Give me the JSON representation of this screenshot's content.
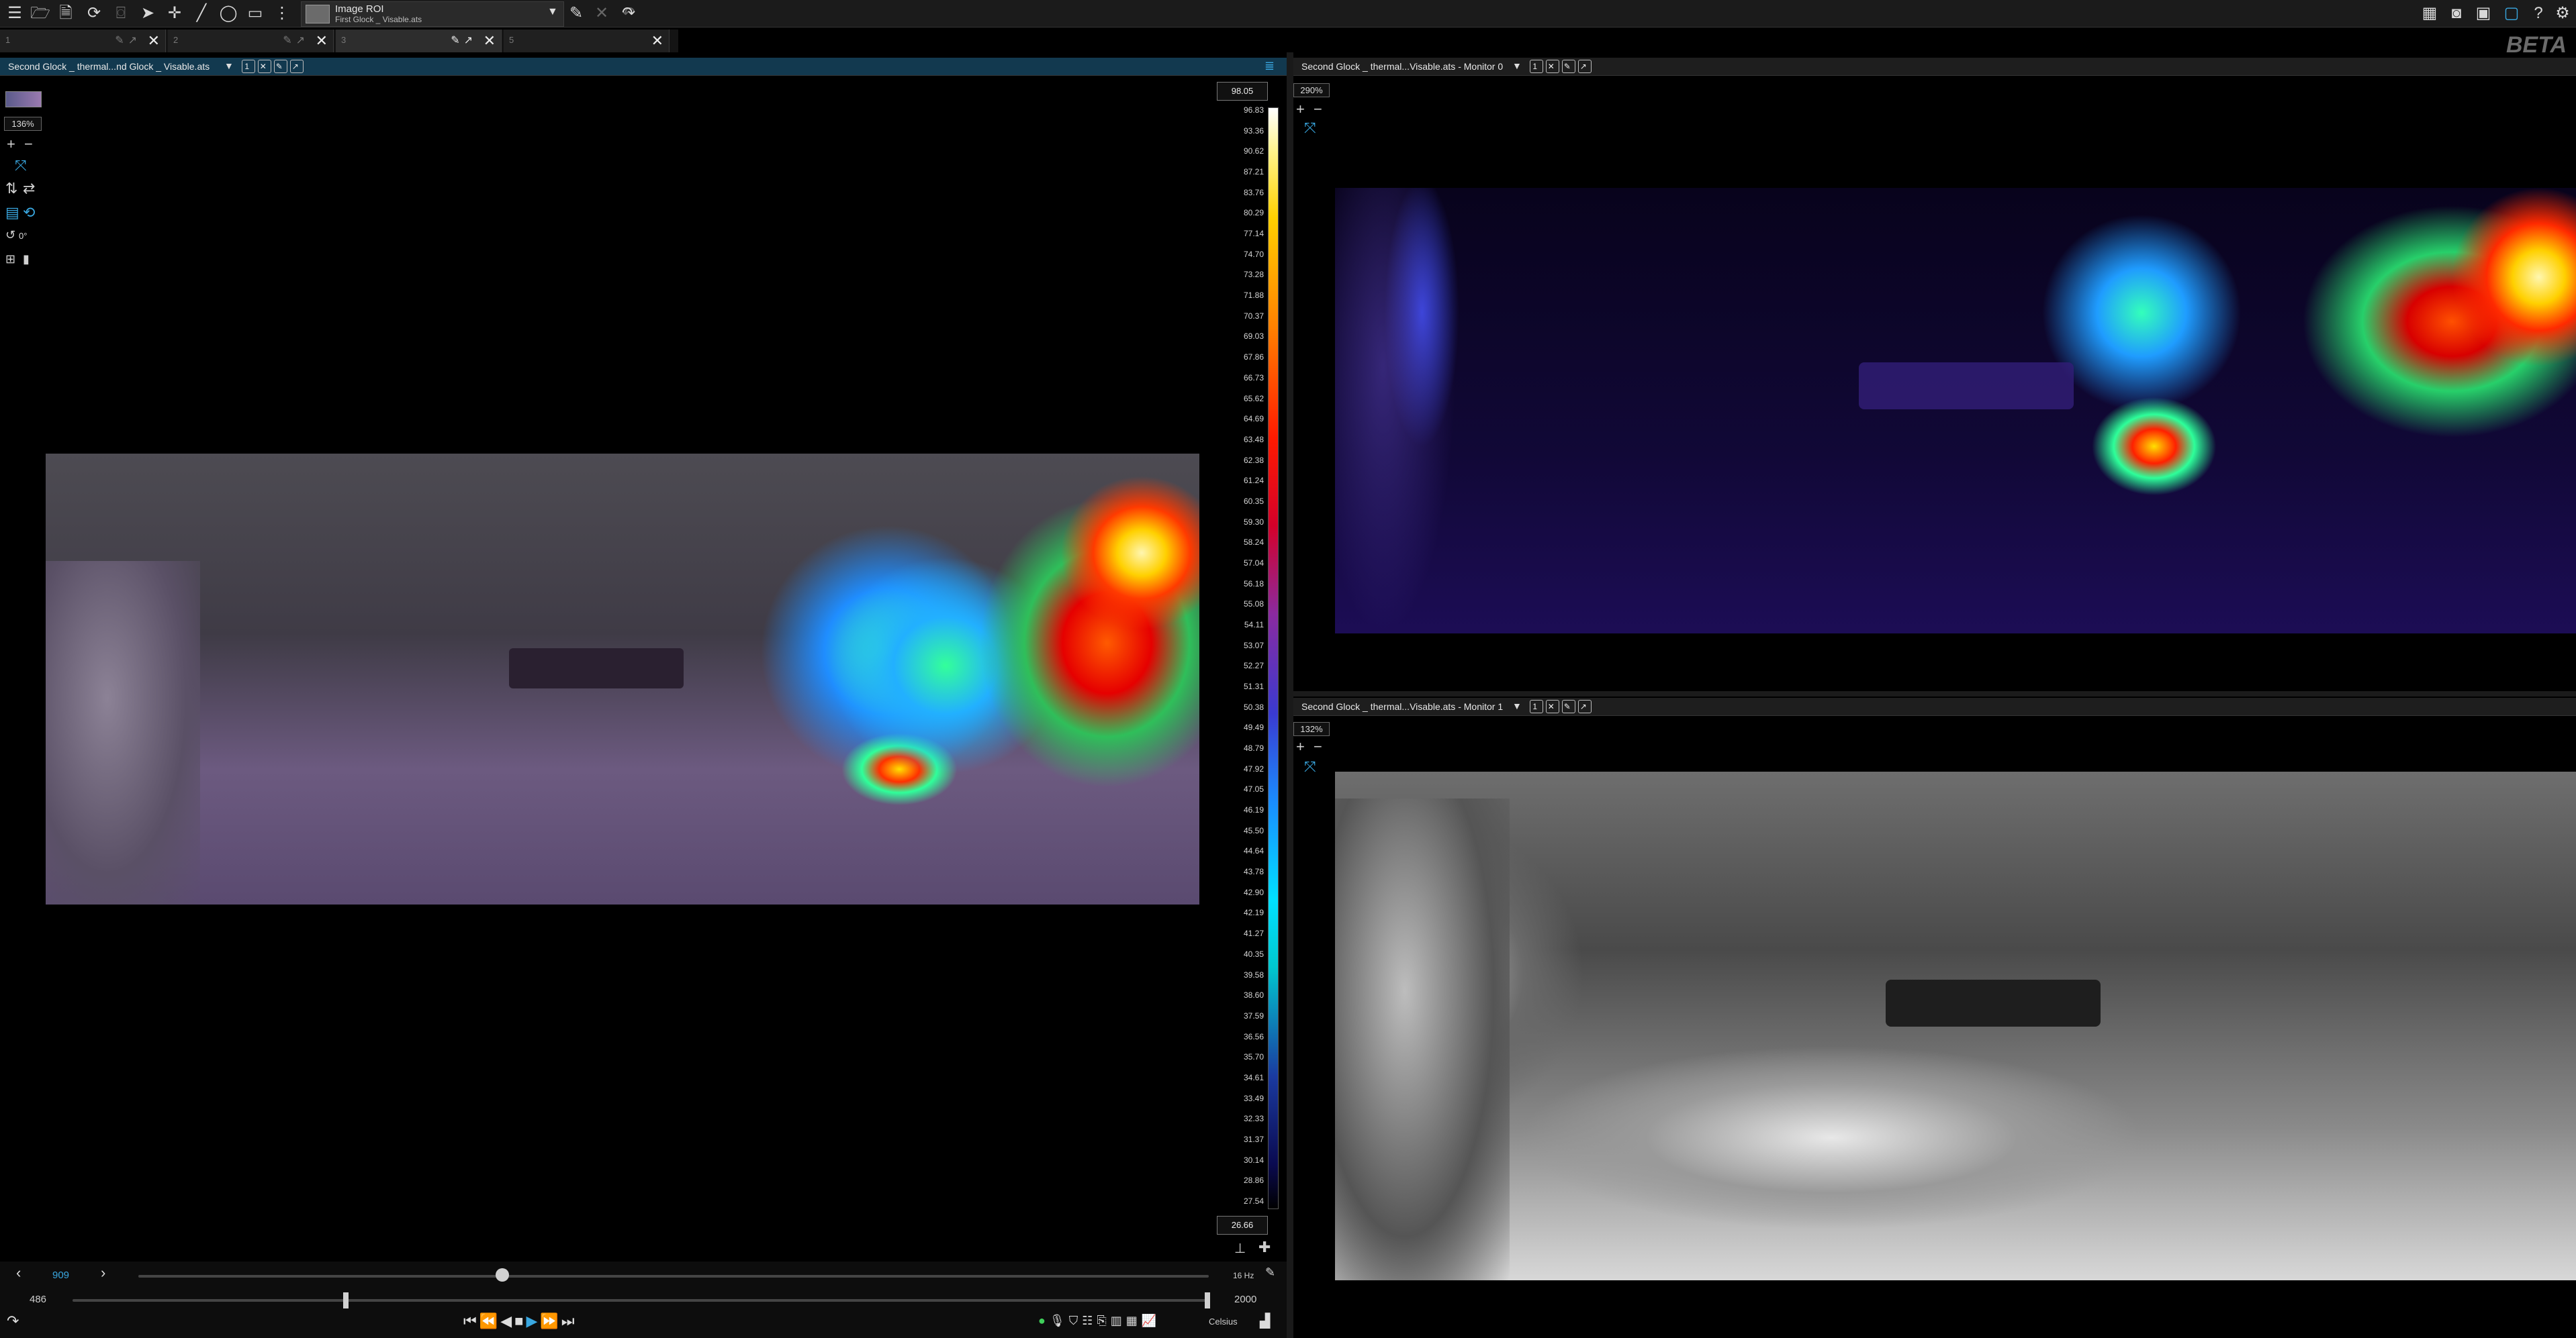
{
  "toolbar": {
    "roi_title": "Image ROI",
    "roi_subtitle": "First Glock _ Visable.ats",
    "beta_label": "BETA"
  },
  "tabs": [
    {
      "label": "1",
      "active": false
    },
    {
      "label": "2",
      "active": false
    },
    {
      "label": "3",
      "active": true
    },
    {
      "label": "5",
      "active": false
    }
  ],
  "main_panel": {
    "title": "Second Glock _ thermal...nd Glock _ Visable.ats",
    "zoom": "136%",
    "rotation": "0°"
  },
  "monitor0": {
    "title": "Second Glock _ thermal...Visable.ats - Monitor 0",
    "zoom": "290%"
  },
  "monitor1": {
    "title": "Second Glock _ thermal...Visable.ats - Monitor 1",
    "zoom": "132%"
  },
  "colorbar": {
    "max": "98.05",
    "min": "26.66",
    "ticks": [
      "96.83",
      "93.36",
      "90.62",
      "87.21",
      "83.76",
      "80.29",
      "77.14",
      "74.70",
      "73.28",
      "71.88",
      "70.37",
      "69.03",
      "67.86",
      "66.73",
      "65.62",
      "64.69",
      "63.48",
      "62.38",
      "61.24",
      "60.35",
      "59.30",
      "58.24",
      "57.04",
      "56.18",
      "55.08",
      "54.11",
      "53.07",
      "52.27",
      "51.31",
      "50.38",
      "49.49",
      "48.79",
      "47.92",
      "47.05",
      "46.19",
      "45.50",
      "44.64",
      "43.78",
      "42.90",
      "42.19",
      "41.27",
      "40.35",
      "39.58",
      "38.60",
      "37.59",
      "36.56",
      "35.70",
      "34.61",
      "33.49",
      "32.33",
      "31.37",
      "30.14",
      "28.86",
      "27.54"
    ],
    "palette": [
      "#ffffff",
      "#ffd000",
      "#ff1a00",
      "#8a2aa0",
      "#1a8cff",
      "#00e0ff",
      "#000000"
    ]
  },
  "playback": {
    "current_frame": "909",
    "range_start": "486",
    "range_end": "2000",
    "frame_rate": "16 Hz",
    "unit": "Celsius",
    "frame_progress": 0.34,
    "range_start_fraction": 0.24,
    "range_end_fraction": 1.0
  }
}
